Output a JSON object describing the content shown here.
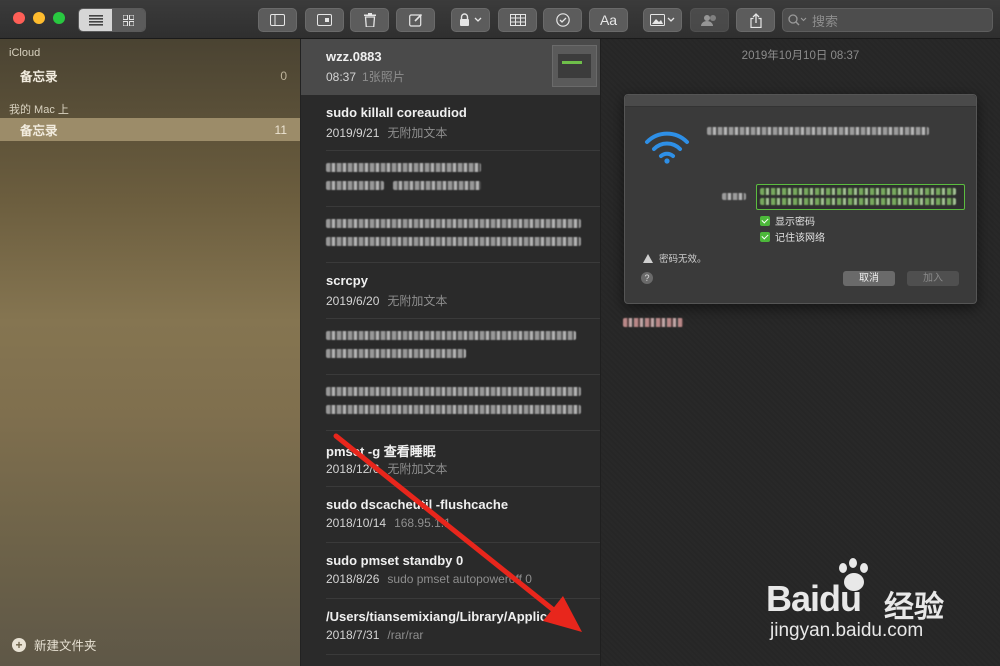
{
  "toolbar": {
    "search_placeholder": "搜索",
    "buttons": [
      "list-view",
      "gallery-view",
      "toggle-sidebar",
      "attachments",
      "delete",
      "compose",
      "lock",
      "table",
      "checklist",
      "format",
      "media",
      "collaborate",
      "share"
    ],
    "format_label": "Aa"
  },
  "sidebar": {
    "sections": [
      {
        "header": "iCloud",
        "items": [
          {
            "label": "备忘录",
            "count": "0"
          }
        ]
      },
      {
        "header": "我的 Mac 上",
        "items": [
          {
            "label": "备忘录",
            "count": "11"
          }
        ]
      }
    ],
    "new_folder_label": "新建文件夹"
  },
  "notes": [
    {
      "title": "wzz.0883",
      "date": "08:37",
      "preview": "1张照片",
      "has_thumbnail": true
    },
    {
      "title": "sudo killall coreaudiod",
      "date": "2019/9/21",
      "preview": "无附加文本"
    },
    {
      "title": "",
      "date": "",
      "preview": "",
      "blurred": true
    },
    {
      "title": "",
      "date": "",
      "preview": "",
      "blurred": true
    },
    {
      "title": "scrcpy",
      "date": "2019/6/20",
      "preview": "无附加文本"
    },
    {
      "title": "",
      "date": "",
      "preview": "",
      "blurred": true
    },
    {
      "title": "",
      "date": "",
      "preview": "",
      "blurred": true
    },
    {
      "title": "pmset -g 查看睡眠",
      "date": "2018/12/6",
      "preview": "无附加文本"
    },
    {
      "title": "sudo dscacheutil -flushcache",
      "date": "2018/10/14",
      "preview": "168.95.1.1"
    },
    {
      "title": "sudo pmset standby 0",
      "date": "2018/8/26",
      "preview": "sudo pmset autopoweroff 0"
    },
    {
      "title": "/Users/tiansemixiang/Library/Applica...",
      "date": "2018/7/31",
      "preview": "/rar/rar"
    }
  ],
  "content": {
    "date": "2019年10月10日 08:37",
    "dialog": {
      "show_password_label": "显示密码",
      "remember_network_label": "记住该网络",
      "warning": "密码无效。",
      "help": "?",
      "cancel_label": "取消",
      "join_label": "加入"
    }
  },
  "watermark": {
    "brand": "Bai",
    "brand_suffix": "du",
    "jingyan": "经验",
    "url": "jingyan.baidu.com"
  },
  "colors": {
    "accent_wifi": "#2e8fe6",
    "selection_sidebar": "#9c8c69",
    "arrow": "#e8261c",
    "checkbox": "#4cb83a"
  }
}
